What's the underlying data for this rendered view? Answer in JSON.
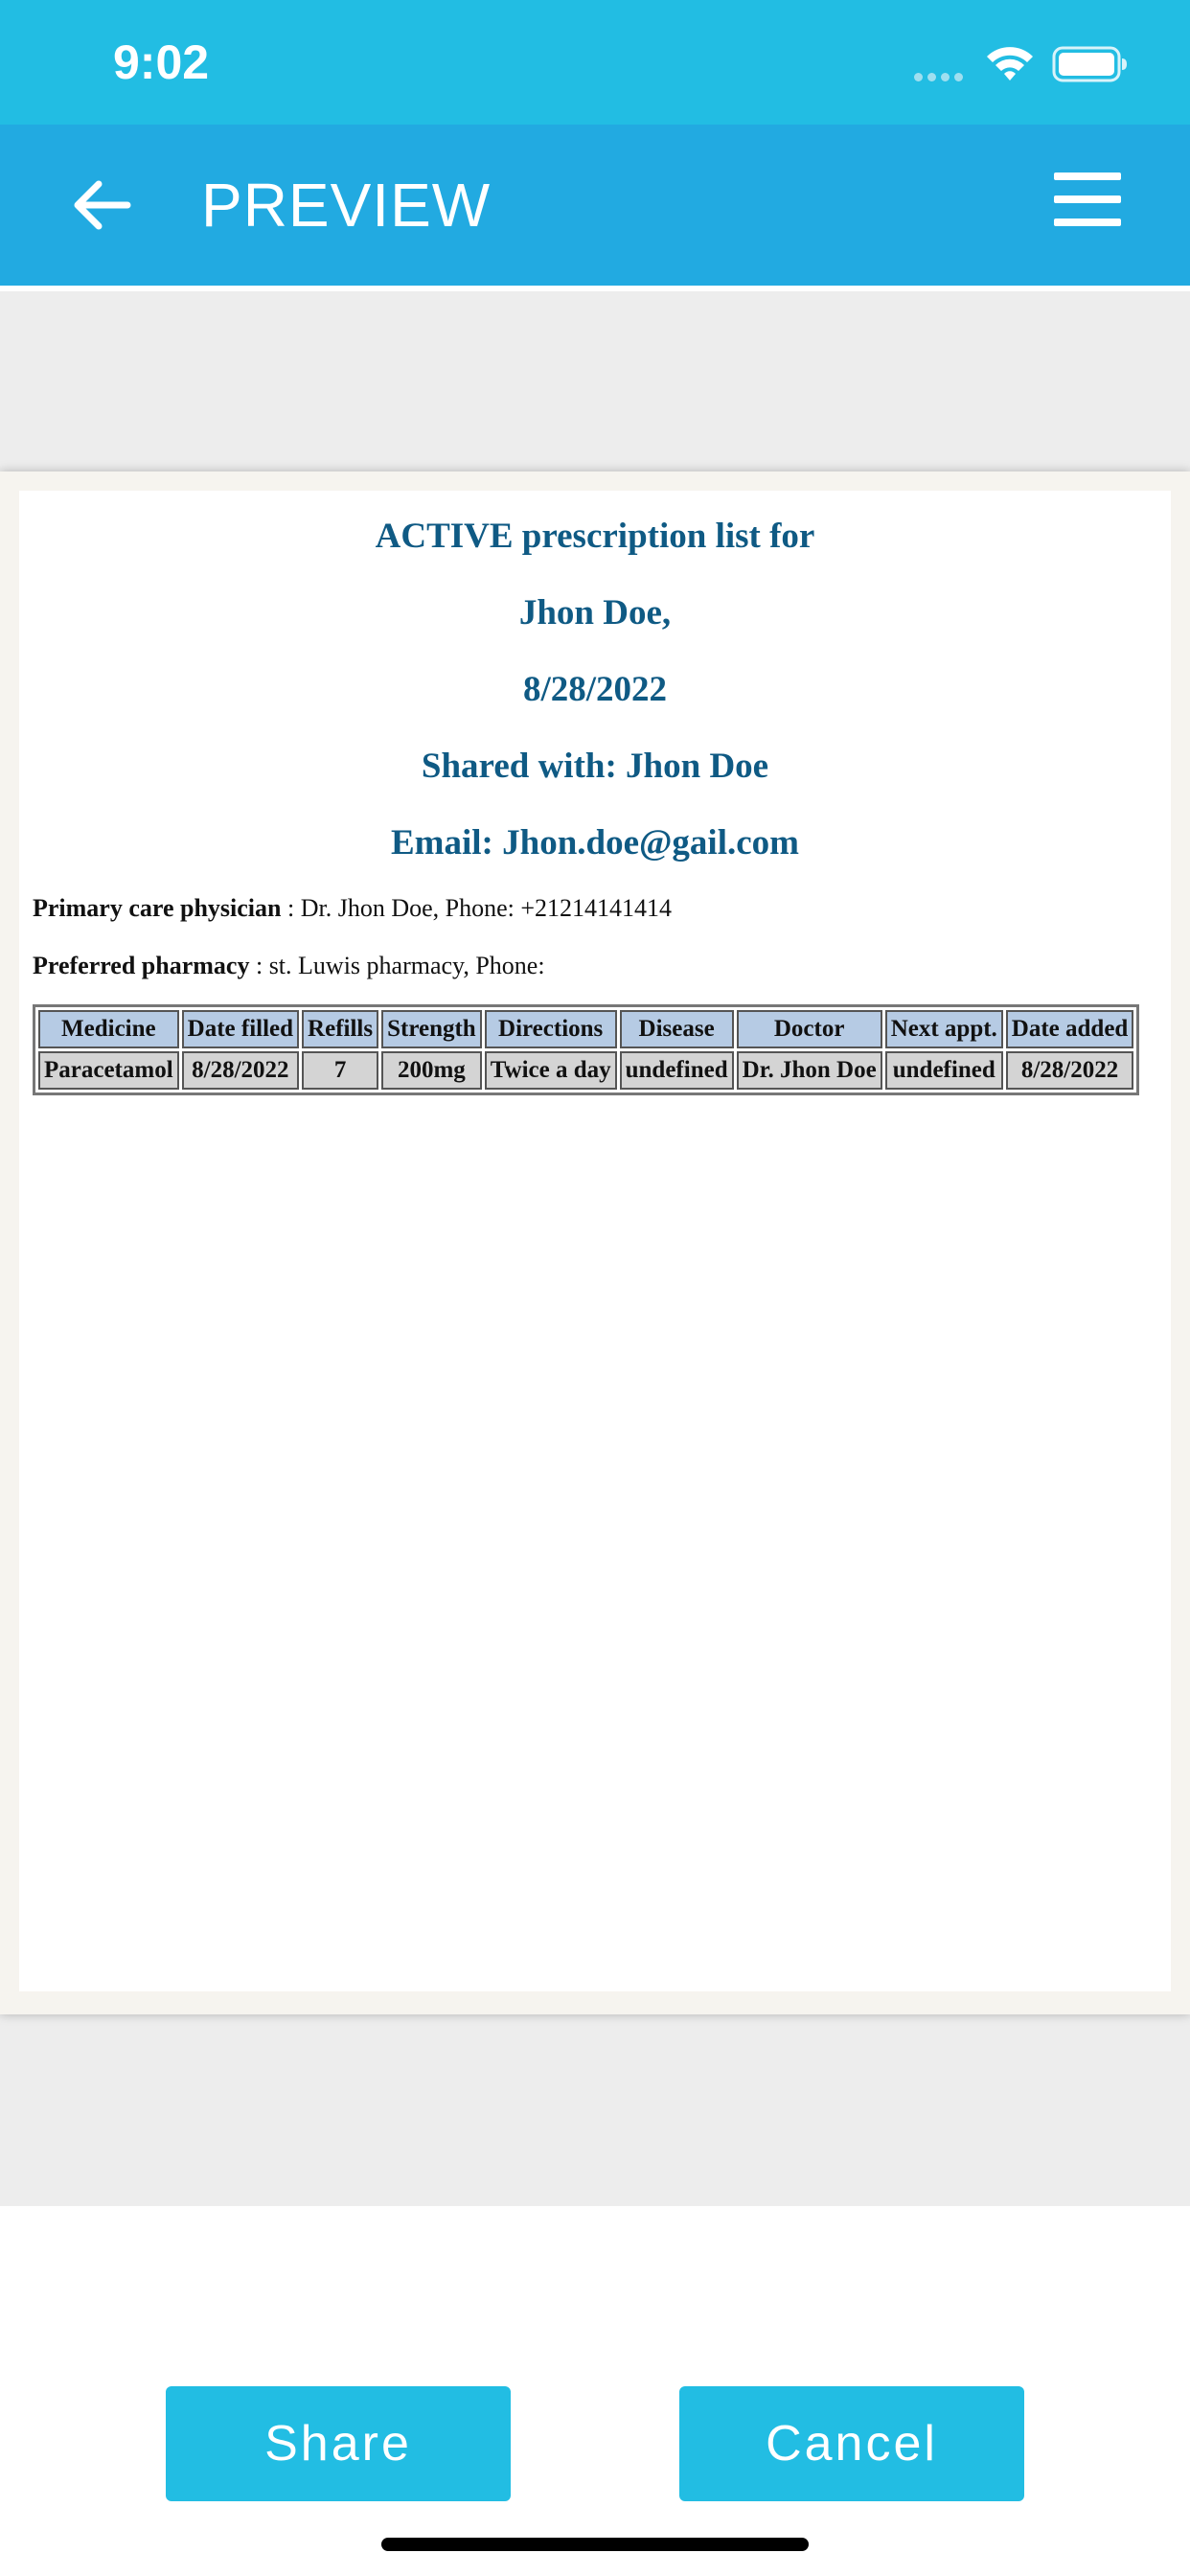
{
  "status_bar": {
    "time": "9:02",
    "icons": [
      "cellular-signal-icon",
      "wifi-icon",
      "battery-icon"
    ]
  },
  "app_bar": {
    "title": "PREVIEW",
    "back_icon": "arrow-left-icon",
    "menu_icon": "hamburger-menu-icon"
  },
  "document": {
    "headings": [
      "ACTIVE prescription list for",
      "Jhon Doe,",
      "8/28/2022",
      "Shared with: Jhon Doe",
      "Email: Jhon.doe@gail.com"
    ],
    "physician_label": "Primary care physician",
    "physician_value": " : Dr. Jhon Doe, Phone: +21214141414",
    "pharmacy_label": "Preferred pharmacy",
    "pharmacy_value": " : st. Luwis pharmacy, Phone:",
    "table": {
      "columns": [
        "Medicine",
        "Date filled",
        "Refills",
        "Strength",
        "Directions",
        "Disease",
        "Doctor",
        "Next appt.",
        "Date added"
      ],
      "rows": [
        [
          "Paracetamol",
          "8/28/2022",
          "7",
          "200mg",
          "Twice a day",
          "undefined",
          "Dr. Jhon Doe",
          "undefined",
          "8/28/2022"
        ]
      ]
    }
  },
  "actions": {
    "share_label": "Share",
    "cancel_label": "Cancel"
  },
  "colors": {
    "status_bar": "#22bde3",
    "app_bar": "#22aae1",
    "heading_text": "#0f5a84",
    "table_header": "#b6cbe4",
    "table_cell": "#d4d4d4",
    "button": "#22bde3"
  }
}
